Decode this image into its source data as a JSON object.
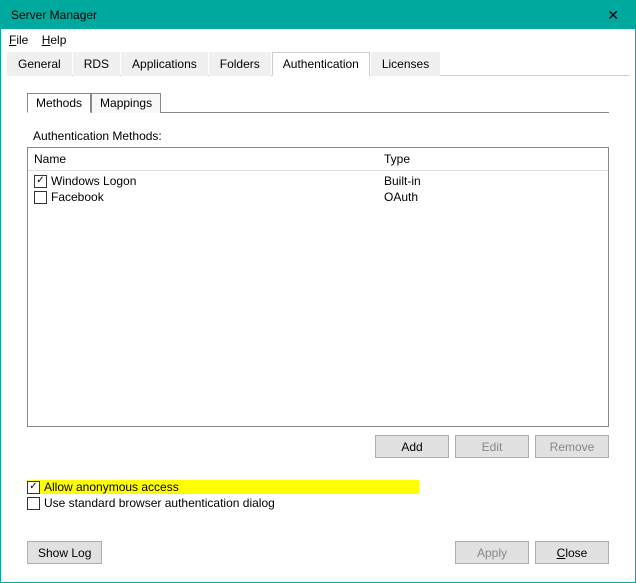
{
  "window": {
    "title": "Server Manager"
  },
  "menu": {
    "file": "File",
    "help": "Help"
  },
  "tabs": {
    "general": "General",
    "rds": "RDS",
    "applications": "Applications",
    "folders": "Folders",
    "authentication": "Authentication",
    "licenses": "Licenses"
  },
  "subtabs": {
    "methods": "Methods",
    "mappings": "Mappings"
  },
  "section": {
    "label": "Authentication Methods:"
  },
  "columns": {
    "name": "Name",
    "type": "Type"
  },
  "rows": {
    "r0": {
      "name": "Windows Logon",
      "type": "Built-in"
    },
    "r1": {
      "name": "Facebook",
      "type": "OAuth"
    }
  },
  "buttons": {
    "add": "Add",
    "edit": "Edit",
    "remove": "Remove"
  },
  "options": {
    "anon": "Allow anonymous access",
    "stddlg": "Use standard browser authentication dialog"
  },
  "footer": {
    "showlog": "Show Log",
    "apply": "Apply",
    "close": "Close"
  }
}
